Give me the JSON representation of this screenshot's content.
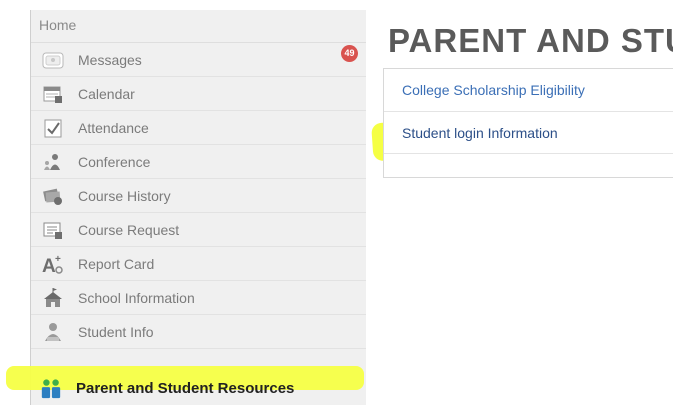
{
  "sidebar": {
    "home": "Home",
    "items": [
      {
        "label": "Messages",
        "icon": "messages-icon",
        "badge": "49"
      },
      {
        "label": "Calendar",
        "icon": "calendar-icon"
      },
      {
        "label": "Attendance",
        "icon": "attendance-icon"
      },
      {
        "label": "Conference",
        "icon": "conference-icon"
      },
      {
        "label": "Course History",
        "icon": "course-history-icon"
      },
      {
        "label": "Course Request",
        "icon": "course-request-icon"
      },
      {
        "label": "Report Card",
        "icon": "report-card-icon"
      },
      {
        "label": "School Information",
        "icon": "school-information-icon"
      },
      {
        "label": "Student Info",
        "icon": "student-info-icon"
      }
    ],
    "active": {
      "label": "Parent and Student Resources",
      "icon": "parent-student-resources-icon"
    }
  },
  "main": {
    "title": "PARENT AND STU",
    "links": [
      "College Scholarship Eligibility",
      "Student login Information"
    ]
  },
  "colors": {
    "highlight": "#f4ff3a",
    "link": "#3b6fb6",
    "badge": "#d9534f"
  }
}
